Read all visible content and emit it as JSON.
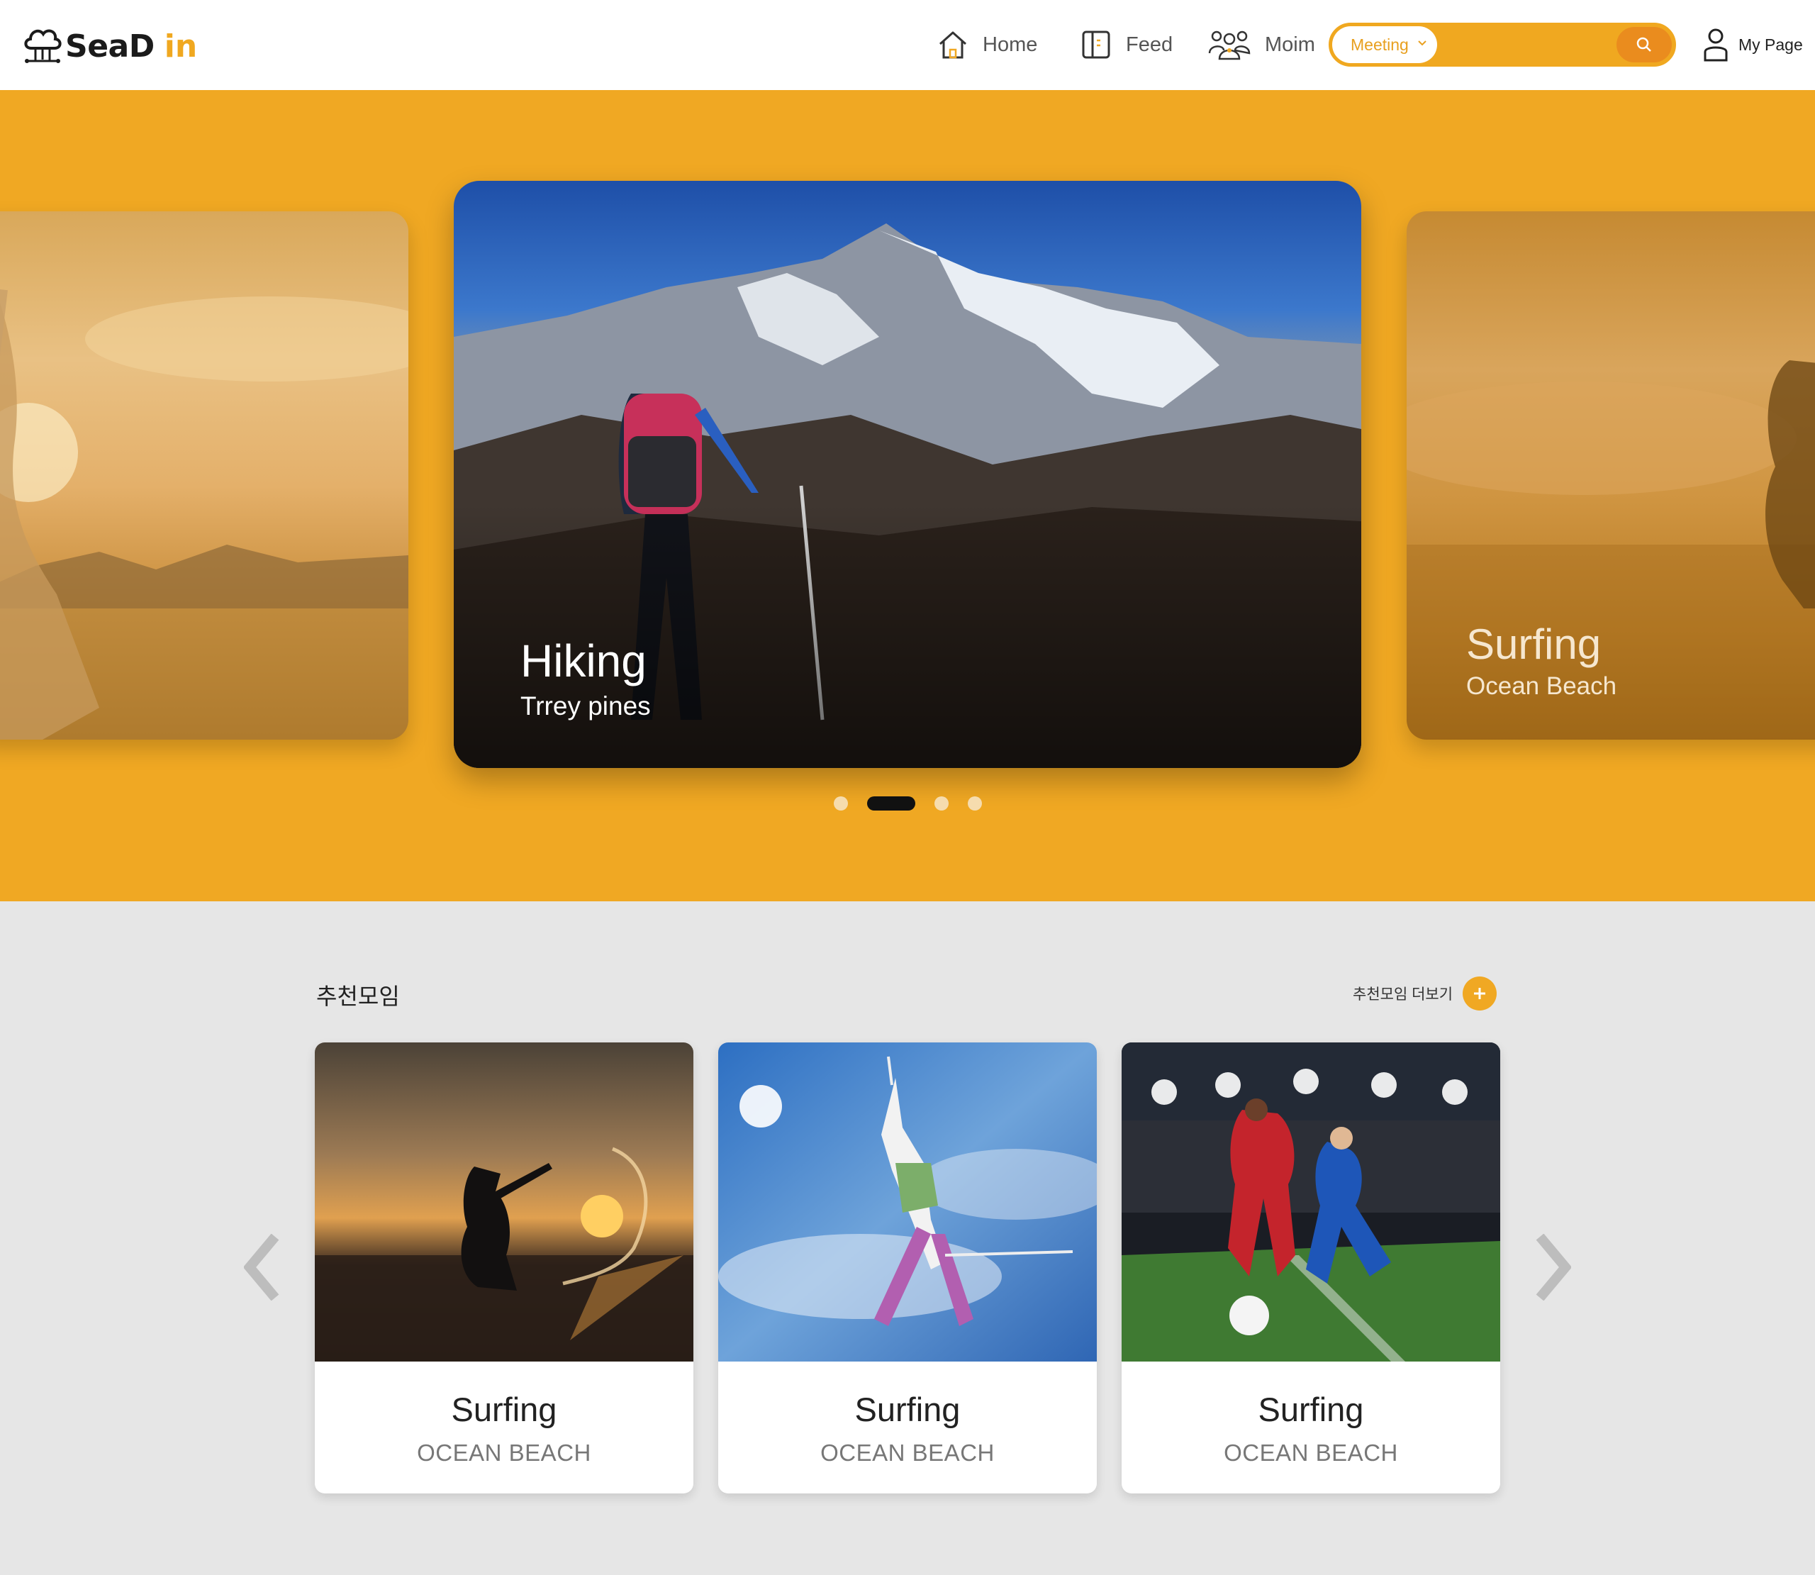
{
  "brand": {
    "logo_text": "SeaD",
    "logo_suffix": "in",
    "accent_color": "#f0a823"
  },
  "nav": {
    "home_label": "Home",
    "feed_label": "Feed",
    "moim_label": "Moim",
    "mypage_label": "My Page"
  },
  "search": {
    "category_selected": "Meeting",
    "query": ""
  },
  "hero": {
    "slides": [
      {
        "title": "",
        "subtitle": ""
      },
      {
        "title": "Hiking",
        "subtitle": "Trrey pines"
      },
      {
        "title": "Surfing",
        "subtitle": "Ocean Beach"
      }
    ],
    "dots_total": 4,
    "active_dot": 2
  },
  "recommended": {
    "title": "추천모임",
    "more_label": "추천모임 더보기",
    "cards": [
      {
        "title": "Surfing",
        "subtitle": "OCEAN BEACH",
        "image": "surfer-sunset"
      },
      {
        "title": "Surfing",
        "subtitle": "OCEAN BEACH",
        "image": "skier-jump"
      },
      {
        "title": "Surfing",
        "subtitle": "OCEAN BEACH",
        "image": "soccer-match"
      }
    ]
  }
}
